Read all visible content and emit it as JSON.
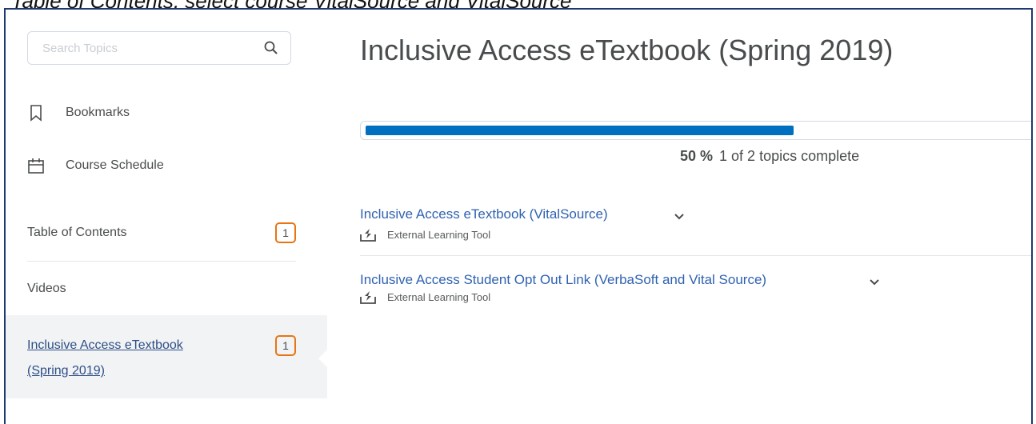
{
  "caption": "Table of Contents, select course VitalSource and VitalSource",
  "sidebar": {
    "search_placeholder": "Search Topics",
    "bookmarks": "Bookmarks",
    "course_schedule": "Course Schedule",
    "toc_label": "Table of Contents",
    "toc_badge": "1",
    "videos": "Videos",
    "active_label": "Inclusive Access eTextbook (Spring 2019)",
    "active_badge": "1"
  },
  "main": {
    "title": "Inclusive Access eTextbook (Spring 2019)",
    "progress_percent": "50 %",
    "progress_text": "1 of 2 topics complete",
    "progress_fraction": 0.5,
    "topics": [
      {
        "title": "Inclusive Access eTextbook (VitalSource)",
        "type": "External Learning Tool"
      },
      {
        "title": "Inclusive Access Student Opt Out Link (VerbaSoft and Vital Source)",
        "type": "External Learning Tool"
      }
    ]
  },
  "colors": {
    "accent": "#006fbf",
    "badge_border": "#e87511",
    "link": "#2f62b0"
  }
}
